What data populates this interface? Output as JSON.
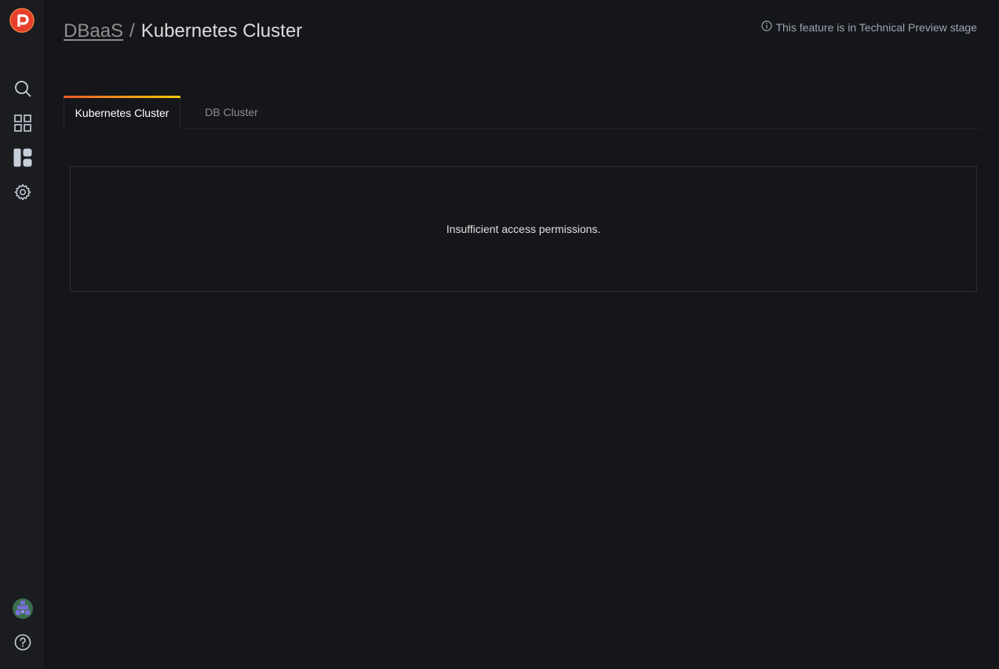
{
  "sidebar": {
    "items": [
      {
        "name": "search",
        "icon": "search-icon"
      },
      {
        "name": "dashboards",
        "icon": "grid-icon"
      },
      {
        "name": "dbaas",
        "icon": "dbaas-icon"
      },
      {
        "name": "configuration",
        "icon": "gear-icon"
      }
    ],
    "bottom": [
      {
        "name": "user",
        "icon": "avatar-icon"
      },
      {
        "name": "help",
        "icon": "help-icon"
      }
    ]
  },
  "header": {
    "breadcrumb_parent": "DBaaS",
    "separator": "/",
    "title": "Kubernetes Cluster"
  },
  "preview_note": {
    "icon": "info-icon",
    "text": "This feature is in Technical Preview stage"
  },
  "tabs": [
    {
      "label": "Kubernetes Cluster",
      "active": true
    },
    {
      "label": "DB Cluster",
      "active": false
    }
  ],
  "message": "Insufficient access permissions.",
  "colors": {
    "background": "#141619",
    "sidebar": "#1b1c20",
    "accent_start": "#f05a28",
    "accent_end": "#fbca0a",
    "logo": "#e6402c"
  }
}
